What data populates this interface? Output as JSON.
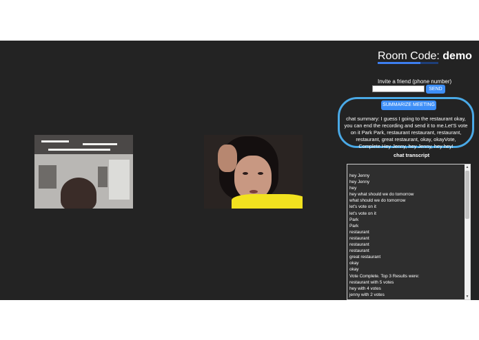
{
  "room": {
    "label": "Room Code:",
    "code": "demo"
  },
  "invite": {
    "label": "Invite a friend (phone number)",
    "input_value": "",
    "send_label": "SEND"
  },
  "summarize_label": "SUMMARIZE MEETING",
  "summary_text": "chat summary: I guess I going to the restaurant okay, you can end the recording and send it to me.Let'S vote on it Park Park, restaurant restaurant, restaurant, restaurant, great restaurant, okay, okayVote, Complete.Hey Jenny, hey Jenny, hey hey!",
  "transcript": {
    "title": "chat transcript",
    "lines": [
      "hey Jenny",
      "hey Jenny",
      " hey",
      " hey what should we do tomorrow",
      " what should we do tomorrow",
      " let's vote on it",
      " let's vote on it",
      " Park",
      " Park",
      " restaurant",
      " restaurant",
      " restaurant",
      " restaurant",
      " great restaurant",
      " okay",
      " okay",
      "Vote Complete. Top 3 Results were:",
      "restaurant with 5 votes",
      "hey with 4 votes",
      "jenny with 2 votes"
    ]
  },
  "colors": {
    "app_background": "#232323",
    "accent": "#3d8ef7",
    "summary_outline": "#4aa9e6"
  }
}
